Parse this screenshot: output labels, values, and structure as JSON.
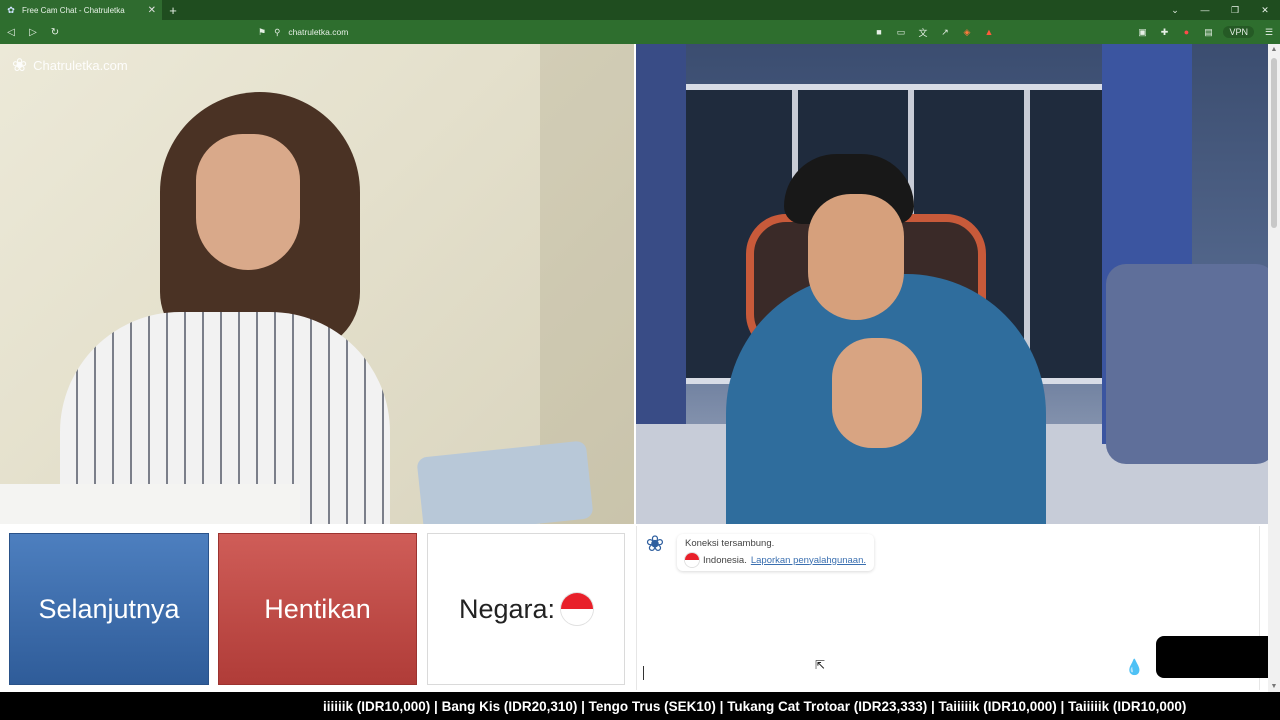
{
  "browser": {
    "tab": {
      "title": "Free Cam Chat - Chatruletka",
      "favicon": "flower-icon"
    },
    "new_tab": "+",
    "address": "chatruletka.com",
    "vpn_label": "VPN",
    "accent_color": "#2e6e2e"
  },
  "site": {
    "logo_text": "Chatruletka.com"
  },
  "controls": {
    "next_label": "Selanjutnya",
    "stop_label": "Hentikan",
    "country_label": "Negara:",
    "next_color": "#3a6aa8",
    "stop_color": "#c04a45"
  },
  "chat": {
    "status": "Koneksi tersambung.",
    "country": "Indonesia.",
    "report_link": "Laporkan penyalahgunaan.",
    "input_value": ""
  },
  "ticker": {
    "text": "iiiiiik (IDR10,000) | Bang Kis (IDR20,310) | Tengo Trus (SEK10) | Tukang Cat Trotoar (IDR23,333) | Taiiiiik (IDR10,000) | Taiiiiik (IDR10,000)"
  }
}
